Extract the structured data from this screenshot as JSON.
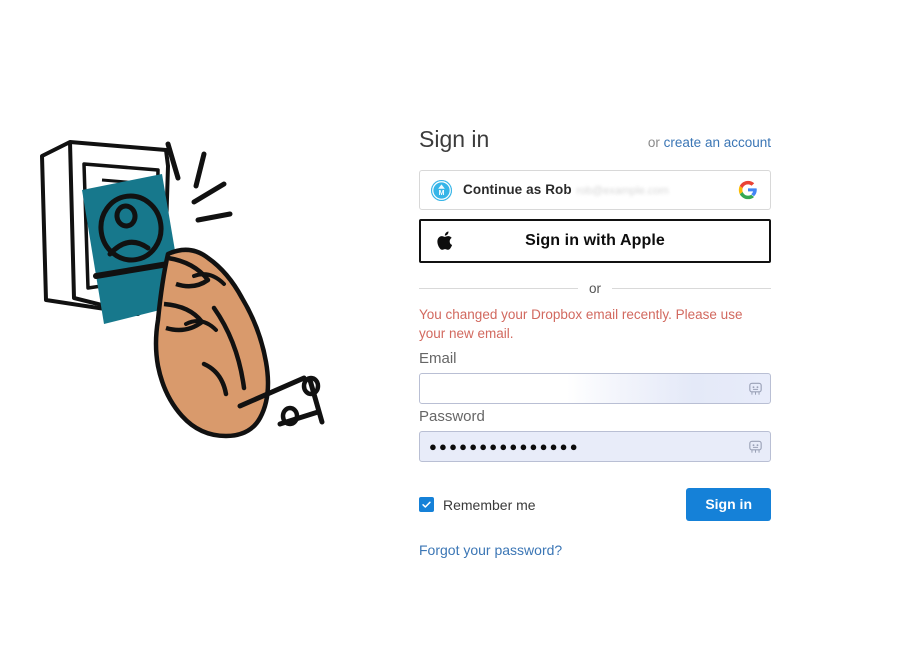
{
  "page": {
    "title": "Sign in",
    "alt_prefix": "or ",
    "alt_link": "create an account"
  },
  "sso": {
    "google": {
      "avatar_letter": "M",
      "primary_label": "Continue as Rob",
      "secondary_label": "rob@example.com",
      "logo_icon": "google-g-icon",
      "avatar_icon": "user-avatar-icon",
      "colors": {
        "avatar_bg": "#36b5e8",
        "google_blue": "#4285f4",
        "google_red": "#ea4335",
        "google_yellow": "#fbbc05",
        "google_green": "#34a853"
      }
    },
    "apple": {
      "label": "Sign in with Apple",
      "logo_icon": "apple-logo-icon"
    }
  },
  "divider": {
    "label": "or"
  },
  "form": {
    "error_message": "You changed your Dropbox email recently. Please use your new email.",
    "error_color": "#d2695f",
    "email": {
      "label": "Email",
      "value": "",
      "placeholder": "",
      "autofill_icon": "password-manager-icon"
    },
    "password": {
      "label": "Password",
      "masked_value": "●●●●●●●●●●●●●●●",
      "placeholder": "",
      "autofill_icon": "password-manager-icon"
    },
    "remember_me": {
      "label": "Remember me",
      "checked": true,
      "check_icon": "checkmark-icon"
    },
    "submit_label": "Sign in",
    "forgot_label": "Forgot your password?",
    "accent_color": "#1581d8",
    "link_color": "#3b76b5"
  },
  "illustration": {
    "name": "hand-holding-id-card-illustration",
    "card_color": "#17788c",
    "skin_color": "#d99a6c",
    "outline_color": "#111111"
  }
}
